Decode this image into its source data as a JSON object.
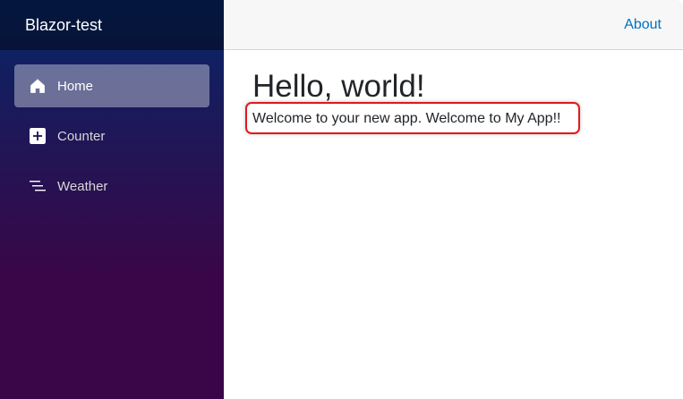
{
  "sidebar": {
    "brand": "Blazor-test",
    "items": [
      {
        "label": "Home",
        "icon": "home-icon",
        "active": true
      },
      {
        "label": "Counter",
        "icon": "plus-square-icon",
        "active": false
      },
      {
        "label": "Weather",
        "icon": "list-icon",
        "active": false
      }
    ]
  },
  "header": {
    "about_label": "About"
  },
  "main": {
    "title": "Hello, world!",
    "welcome_text": "Welcome to your new app. Welcome to My App!!"
  },
  "colors": {
    "sidebar_top": "#052767",
    "sidebar_bottom": "#3a0647",
    "link": "#0071c1",
    "highlight_border": "#e0191b"
  }
}
